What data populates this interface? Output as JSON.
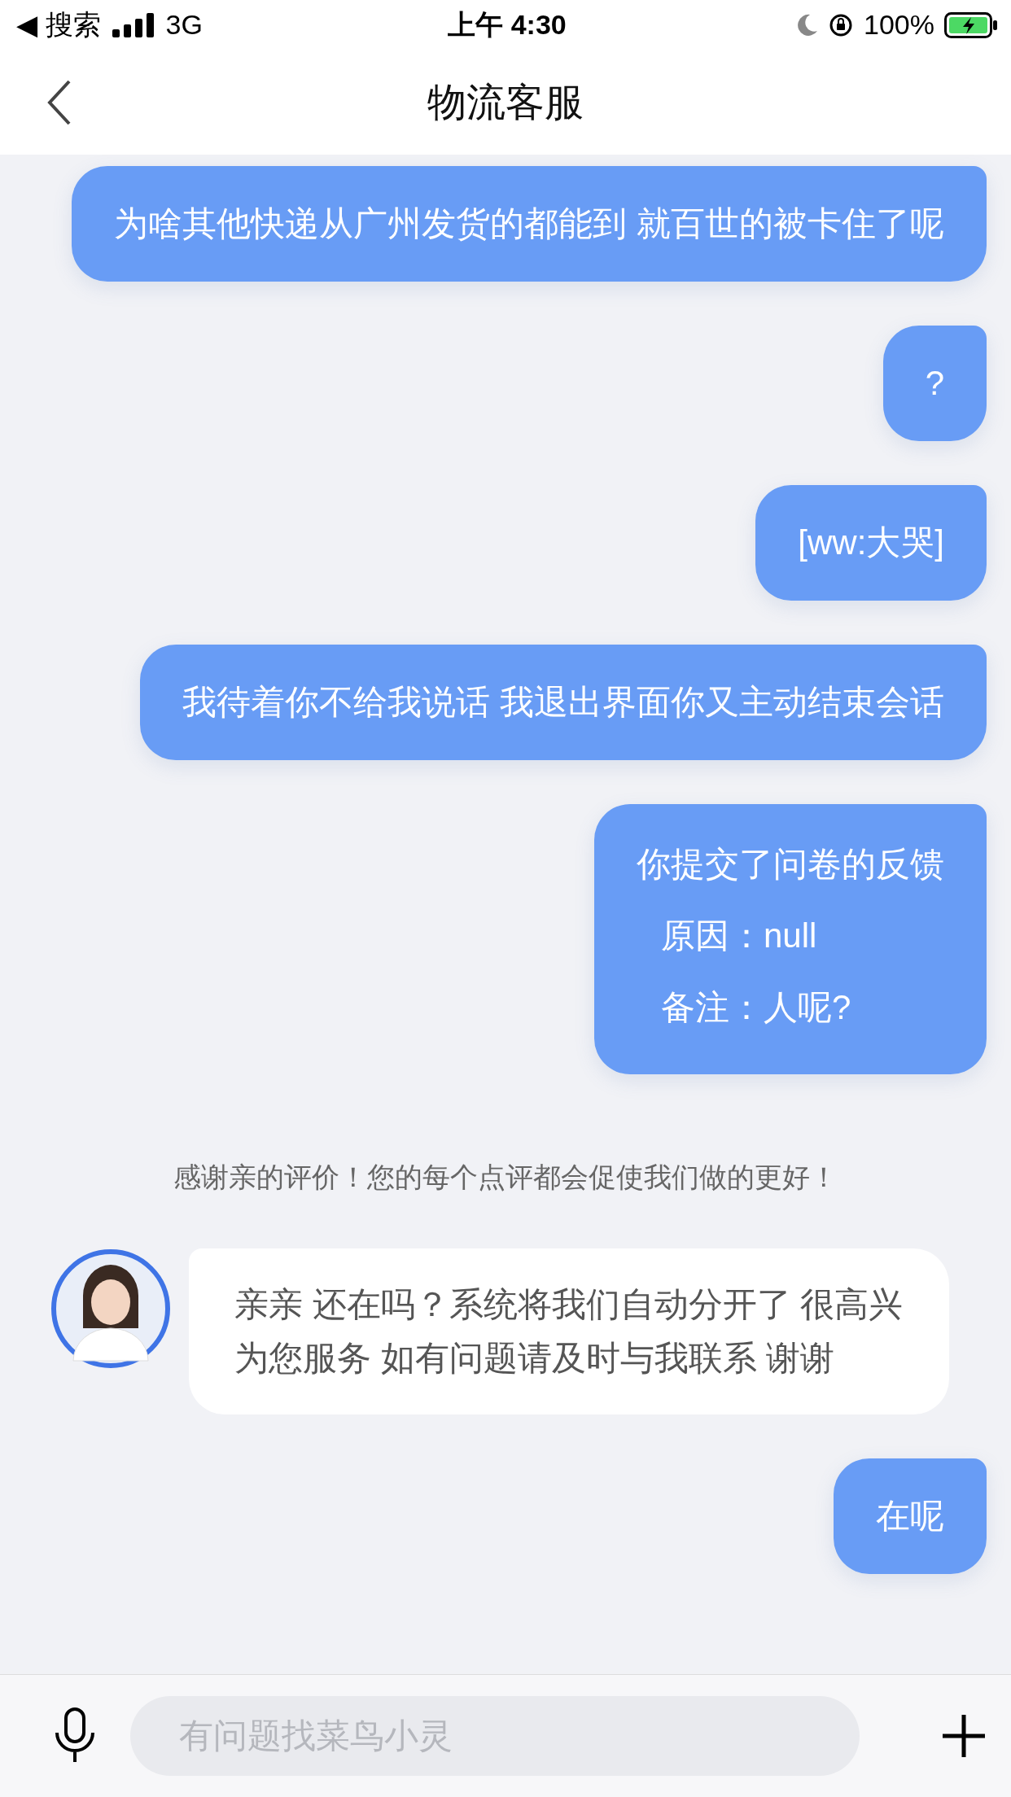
{
  "status_bar": {
    "back_label": "◀ 搜索",
    "network": "3G",
    "time": "上午 4:30",
    "battery": "100%"
  },
  "nav": {
    "title": "物流客服"
  },
  "messages": [
    {
      "kind": "outgoing",
      "lines": [
        "为啥其他快递从广州发货的都能到 就百世的被卡住了呢"
      ]
    },
    {
      "kind": "outgoing",
      "lines": [
        "?"
      ]
    },
    {
      "kind": "outgoing",
      "lines": [
        "[ww:大哭]"
      ]
    },
    {
      "kind": "outgoing",
      "lines": [
        "我待着你不给我说话 我退出界面你又主动结束会话"
      ]
    },
    {
      "kind": "survey",
      "lines": [
        "你提交了问卷的反馈",
        "原因：null",
        "备注：人呢?"
      ]
    },
    {
      "kind": "system",
      "lines": [
        "感谢亲的评价！您的每个点评都会促使我们做的更好！"
      ]
    },
    {
      "kind": "incoming",
      "lines": [
        "亲亲 还在吗？系统将我们自动分开了 很高兴为您服务 如有问题请及时与我联系 谢谢"
      ]
    },
    {
      "kind": "outgoing",
      "lines": [
        "在呢"
      ]
    }
  ],
  "input": {
    "placeholder": "有问题找菜鸟小灵"
  }
}
